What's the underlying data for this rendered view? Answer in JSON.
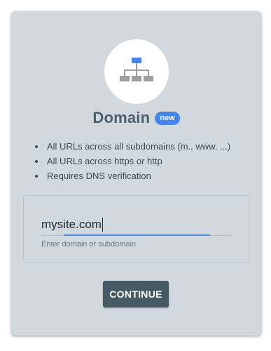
{
  "card": {
    "title": "Domain",
    "badge": "new",
    "icon": "sitemap-icon",
    "features": [
      "All URLs across all subdomains (m., www. ...)",
      "All URLs across https or http",
      "Requires DNS verification"
    ]
  },
  "domain_input": {
    "value": "mysite.com",
    "helper": "Enter domain or subdomain"
  },
  "actions": {
    "continue_label": "CONTINUE"
  },
  "colors": {
    "card_bg": "#d1d9df",
    "accent": "#4285f4",
    "button_bg": "#455a64",
    "title": "#4d5f6b"
  }
}
